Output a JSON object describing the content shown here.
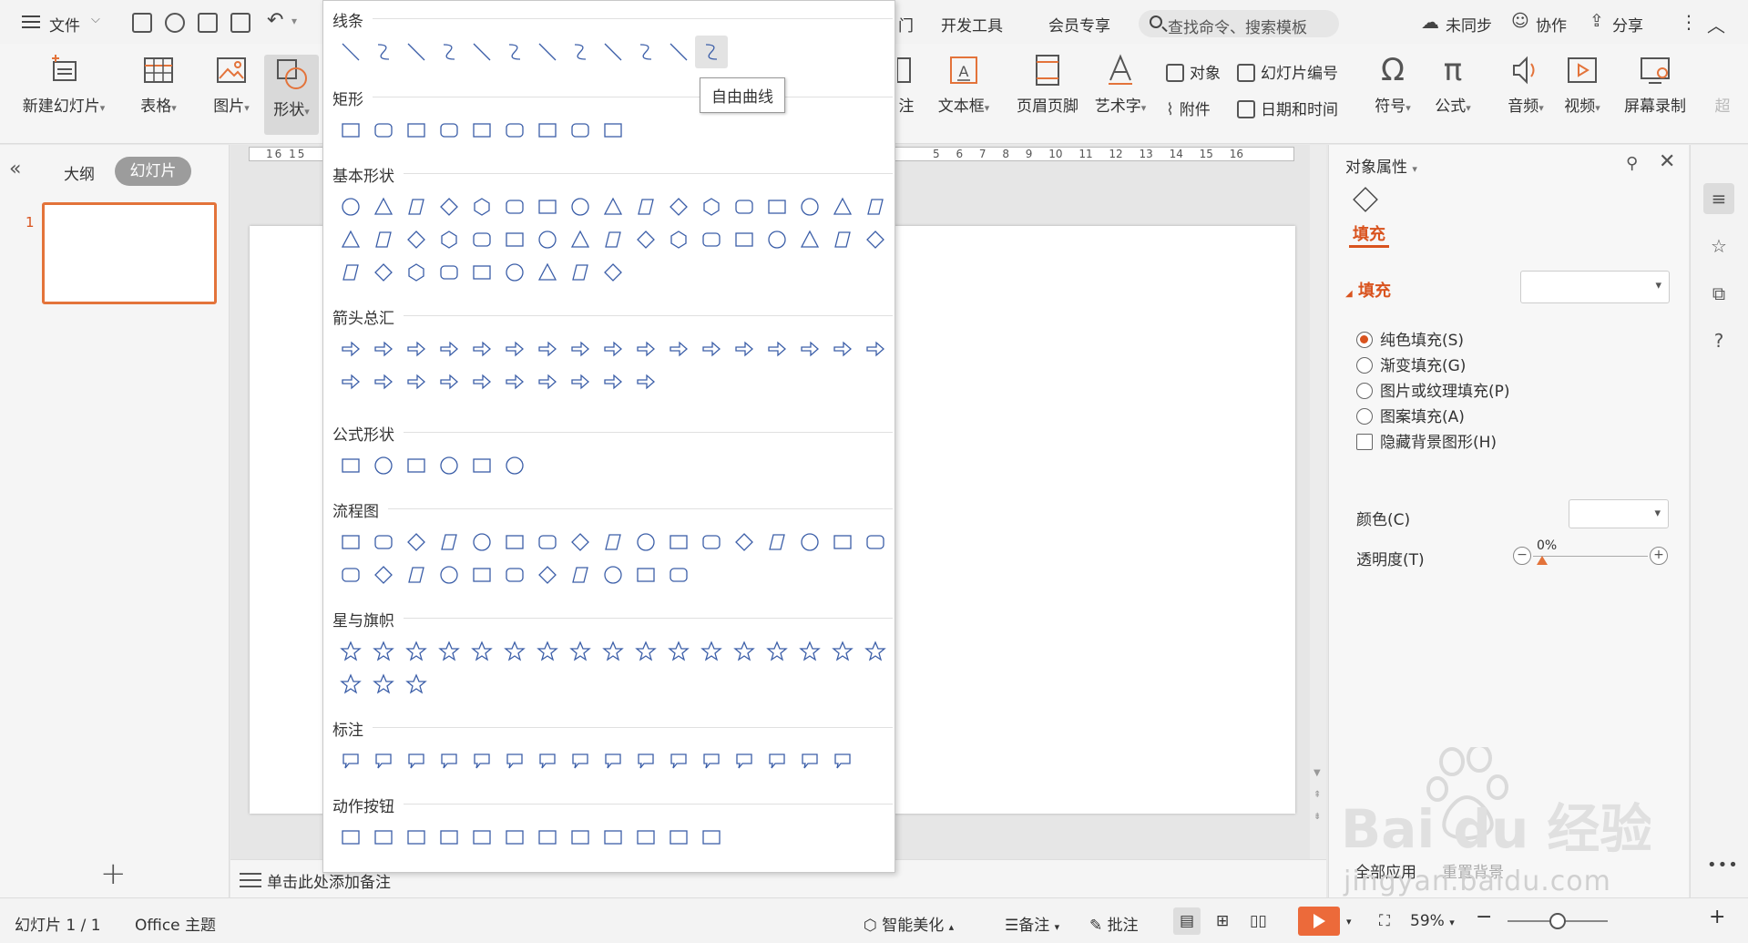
{
  "topbar": {
    "file_menu": "文件",
    "menus": [
      "开发工具",
      "会员专享"
    ],
    "search_placeholder": "查找命令、搜索模板",
    "sync": "未同步",
    "collab": "协作",
    "share": "分享"
  },
  "ribbon": {
    "new_slide": "新建幻灯片",
    "table": "表格",
    "picture": "图片",
    "shapes": "形状",
    "notes_partial": "注",
    "textbox": "文本框",
    "header_footer": "页眉页脚",
    "wordart": "艺术字",
    "object": "对象",
    "slide_number": "幻灯片编号",
    "attachment": "附件",
    "date_time": "日期和时间",
    "symbol": "符号",
    "formula": "公式",
    "audio": "音频",
    "video": "视频",
    "screen_record": "屏幕录制",
    "more_partial": "超"
  },
  "left_panel": {
    "tab_outline": "大纲",
    "tab_slides": "幻灯片",
    "slide_number": "1",
    "add_slide": "+"
  },
  "canvas": {
    "ruler_left": "16 15",
    "ruler_right": "5 6 7 8 9 10 11 12 13 14 15 16",
    "notes_placeholder": "单击此处添加备注"
  },
  "shapes_panel": {
    "categories": [
      {
        "title": "线条",
        "rows": [
          12
        ]
      },
      {
        "title": "矩形",
        "rows": [
          9
        ]
      },
      {
        "title": "基本形状",
        "rows": [
          17,
          17,
          9
        ]
      },
      {
        "title": "箭头总汇",
        "rows": [
          17,
          10
        ]
      },
      {
        "title": "公式形状",
        "rows": [
          6
        ]
      },
      {
        "title": "流程图",
        "rows": [
          17,
          11
        ]
      },
      {
        "title": "星与旗帜",
        "rows": [
          17,
          3
        ]
      },
      {
        "title": "标注",
        "rows": [
          16
        ]
      },
      {
        "title": "动作按钮",
        "rows": [
          12
        ]
      }
    ],
    "tooltip": "自由曲线"
  },
  "right_panel": {
    "title": "对象属性",
    "tab_fill": "填充",
    "section_fill": "填充",
    "options": [
      {
        "label": "纯色填充(S)",
        "checked": true
      },
      {
        "label": "渐变填充(G)",
        "checked": false
      },
      {
        "label": "图片或纹理填充(P)",
        "checked": false
      },
      {
        "label": "图案填充(A)",
        "checked": false
      }
    ],
    "hide_bg": "隐藏背景图形(H)",
    "color_label": "颜色(C)",
    "transparency_label": "透明度(T)",
    "transparency_value": "0%",
    "apply_all": "全部应用",
    "reset_bg": "重置背景"
  },
  "statusbar": {
    "slide_info": "幻灯片 1 / 1",
    "theme": "Office 主题",
    "smart_beautify": "智能美化",
    "notes": "备注",
    "comments": "批注",
    "zoom": "59%"
  },
  "watermark": {
    "brand": "Bai du 经验",
    "url": "jingyan.baidu.com"
  },
  "colors": {
    "accent": "#d9531e",
    "shape_stroke": "#3b5ea8",
    "play_button": "#ec6a3a"
  }
}
